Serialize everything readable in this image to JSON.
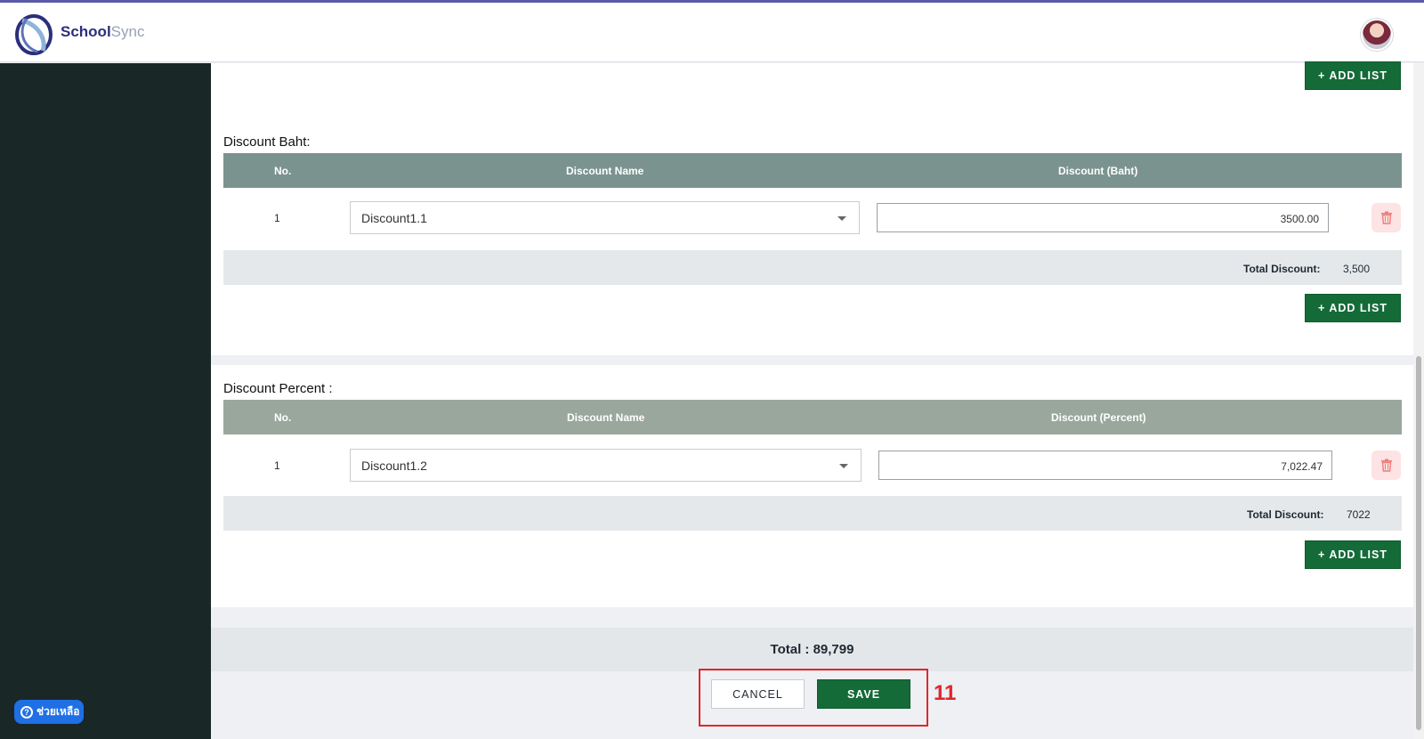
{
  "app": {
    "brand_school": "School",
    "brand_sync": "Sync"
  },
  "help": {
    "label": "ช่วยเหลือ"
  },
  "add_list_label": "+ ADD LIST",
  "discount_baht": {
    "title": "Discount Baht:",
    "columns": {
      "no": "No.",
      "name": "Discount Name",
      "value": "Discount (Baht)"
    },
    "rows": [
      {
        "no": "1",
        "name": "Discount1.1",
        "value": "3500.00"
      }
    ],
    "total_label": "Total Discount:",
    "total_value": "3,500"
  },
  "discount_percent": {
    "title": "Discount Percent :",
    "columns": {
      "no": "No.",
      "name": "Discount Name",
      "value": "Discount (Percent)"
    },
    "rows": [
      {
        "no": "1",
        "name": "Discount1.2",
        "value": "7,022.47"
      }
    ],
    "total_label": "Total Discount:",
    "total_value": "7022"
  },
  "grand_total": "Total : 89,799",
  "actions": {
    "cancel": "CANCEL",
    "save": "SAVE"
  },
  "annotation": {
    "number": "11",
    "color": "#e0262c"
  },
  "colors": {
    "primary_green": "#146b38",
    "sidebar": "#192726",
    "delete_bg": "#fde3e3"
  }
}
